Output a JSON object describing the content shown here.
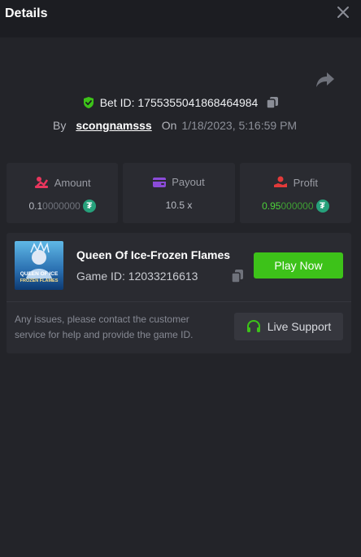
{
  "header": {
    "title": "Details"
  },
  "bet": {
    "id_label": "Bet ID: 1755355041868464984",
    "by_label": "By",
    "username": "scongnamsss",
    "on_label": "On",
    "datetime": "1/18/2023, 5:16:59 PM"
  },
  "stats": {
    "amount": {
      "label": "Amount",
      "value_main": "0.1",
      "value_dim": "0000000"
    },
    "payout": {
      "label": "Payout",
      "value": "10.5 x"
    },
    "profit": {
      "label": "Profit",
      "value_main": "0.95",
      "value_dim": "000000"
    }
  },
  "game": {
    "title": "Queen Of Ice-Frozen Flames",
    "id_label": "Game ID: 12033216613",
    "thumb_text": "QUEEN OF ICE FROZEN FLAMES",
    "play_label": "Play Now"
  },
  "support": {
    "notice": "Any issues, please contact the customer service for help and provide the game ID.",
    "button_label": "Live Support"
  },
  "icons": {
    "currency": "tether-icon",
    "shield": "shield-check-icon",
    "copy": "copy-icon",
    "share": "share-icon",
    "close": "close-icon",
    "headphones": "headphones-icon"
  },
  "colors": {
    "accent_green": "#3dc219",
    "profit_green": "#4dd13a",
    "amount_icon": "#e8365d",
    "payout_icon": "#8b4bd8",
    "profit_icon": "#e23a3a",
    "tether": "#26a17b",
    "background": "#232429",
    "header_bg": "#1c1d22"
  }
}
